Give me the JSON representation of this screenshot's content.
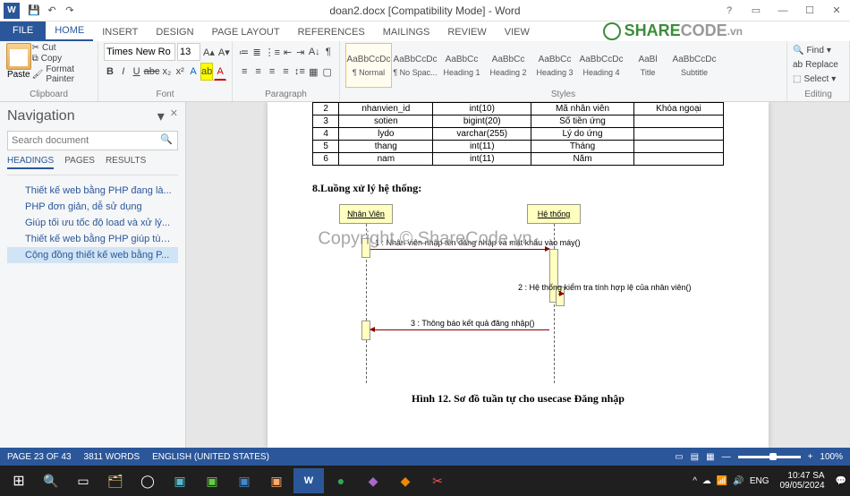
{
  "title": "doan2.docx [Compatibility Mode] - Word",
  "watermark_brand": {
    "share": "SHARE",
    "code": "CODE",
    "suffix": ".vn"
  },
  "watermark_center": "Copyright © ShareCode.vn",
  "ribbon_tabs": {
    "file": "FILE",
    "home": "HOME",
    "insert": "INSERT",
    "design": "DESIGN",
    "page_layout": "PAGE LAYOUT",
    "references": "REFERENCES",
    "mailings": "MAILINGS",
    "review": "REVIEW",
    "view": "VIEW"
  },
  "clipboard": {
    "paste": "Paste",
    "cut": "Cut",
    "copy": "Copy",
    "format_painter": "Format Painter",
    "label": "Clipboard"
  },
  "font": {
    "name": "Times New Ro",
    "size": "13",
    "label": "Font"
  },
  "paragraph": {
    "label": "Paragraph"
  },
  "styles": {
    "label": "Styles",
    "items": [
      {
        "sample": "AaBbCcDc",
        "name": "¶ Normal"
      },
      {
        "sample": "AaBbCcDc",
        "name": "¶ No Spac..."
      },
      {
        "sample": "AaBbCc",
        "name": "Heading 1"
      },
      {
        "sample": "AaBbCc",
        "name": "Heading 2"
      },
      {
        "sample": "AaBbCc",
        "name": "Heading 3"
      },
      {
        "sample": "AaBbCcDc",
        "name": "Heading 4"
      },
      {
        "sample": "AaBl",
        "name": "Title"
      },
      {
        "sample": "AaBbCcDc",
        "name": "Subtitle"
      }
    ]
  },
  "editing": {
    "find": "Find",
    "replace": "Replace",
    "select": "Select",
    "label": "Editing"
  },
  "nav": {
    "title": "Navigation",
    "search_placeholder": "Search document",
    "tabs": {
      "headings": "HEADINGS",
      "pages": "PAGES",
      "results": "RESULTS"
    },
    "items": [
      "Thiết kế web bằng PHP đang là...",
      "PHP đơn giản, dễ sử dụng",
      "Giúp tối ưu tốc độ load và xử lý...",
      "Thiết kế web bằng PHP giúp tùy...",
      "Cộng đồng thiết kế web bằng P..."
    ]
  },
  "table": {
    "rows": [
      [
        "2",
        "nhanvien_id",
        "int(10)",
        "Mã nhân viên",
        "Khóa ngoại"
      ],
      [
        "3",
        "sotien",
        "bigint(20)",
        "Số tiền ứng",
        ""
      ],
      [
        "4",
        "lydo",
        "varchar(255)",
        "Lý do ứng",
        ""
      ],
      [
        "5",
        "thang",
        "int(11)",
        "Tháng",
        ""
      ],
      [
        "6",
        "nam",
        "int(11)",
        "Năm",
        ""
      ]
    ]
  },
  "section_heading": "8.Luồng xử lý hệ thống:",
  "seq": {
    "actor_left": "Nhân Viên",
    "actor_right": "Hệ thống",
    "msg1": "1 : Nhân viên nhập tên đăng nhập và mật khẩu vào máy()",
    "msg2": "2 : Hệ thống kiểm tra tính hợp lệ của nhân viên()",
    "msg3": "3 : Thông báo kết quả đăng nhập()"
  },
  "figure_caption": "Hình 12. Sơ đồ tuần tự cho usecase Đăng nhập",
  "status": {
    "page": "PAGE 23 OF 43",
    "words": "3811 WORDS",
    "lang": "ENGLISH (UNITED STATES)",
    "zoom": "100%"
  },
  "tray": {
    "lang": "ENG",
    "time": "10:47 SA",
    "date": "09/05/2024"
  }
}
